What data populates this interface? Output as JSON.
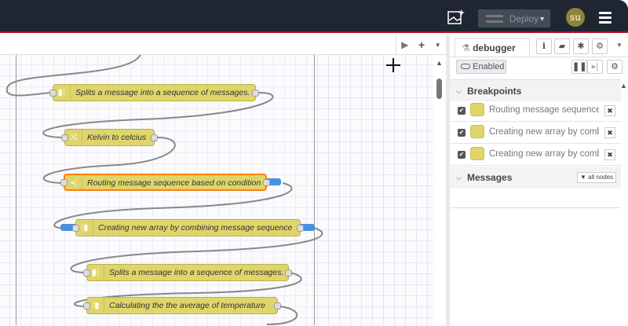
{
  "header": {
    "deploy_label": "Deploy",
    "user_initials": "su"
  },
  "icons": [
    "ai-sparkle-icon",
    "deploy-flow-icon",
    "caret-down-icon",
    "menu-icon",
    "play-icon",
    "plus-icon",
    "flask-icon",
    "info-icon",
    "book-icon",
    "bug-icon",
    "gear-icon",
    "pause-icon",
    "step-icon",
    "filter-icon"
  ],
  "sidebar": {
    "tab_label": "debugger",
    "enabled_label": "Enabled",
    "breakpoints_title": "Breakpoints",
    "messages_title": "Messages",
    "filter_label": "all nodes",
    "breakpoints": [
      {
        "label": "Routing message sequence based on condition"
      },
      {
        "label": "Creating new array by combining message sequence"
      },
      {
        "label": "Creating new array by combining message sequence"
      }
    ]
  },
  "flow": {
    "nodes": [
      {
        "label": "Splits a message into a sequence of messages."
      },
      {
        "label": "Kelvin to celcius"
      },
      {
        "label": "Routing message sequence based on condition"
      },
      {
        "label": "Creating new array by combining message sequence"
      },
      {
        "label": "Splits a message into a sequence of messages."
      },
      {
        "label": "Calculating the the average of temperature"
      }
    ]
  },
  "colors": {
    "header": "#1f2631",
    "node": "#dfd56b",
    "selected": "#ff7f0e",
    "breakpoint": "#4a90e2"
  }
}
